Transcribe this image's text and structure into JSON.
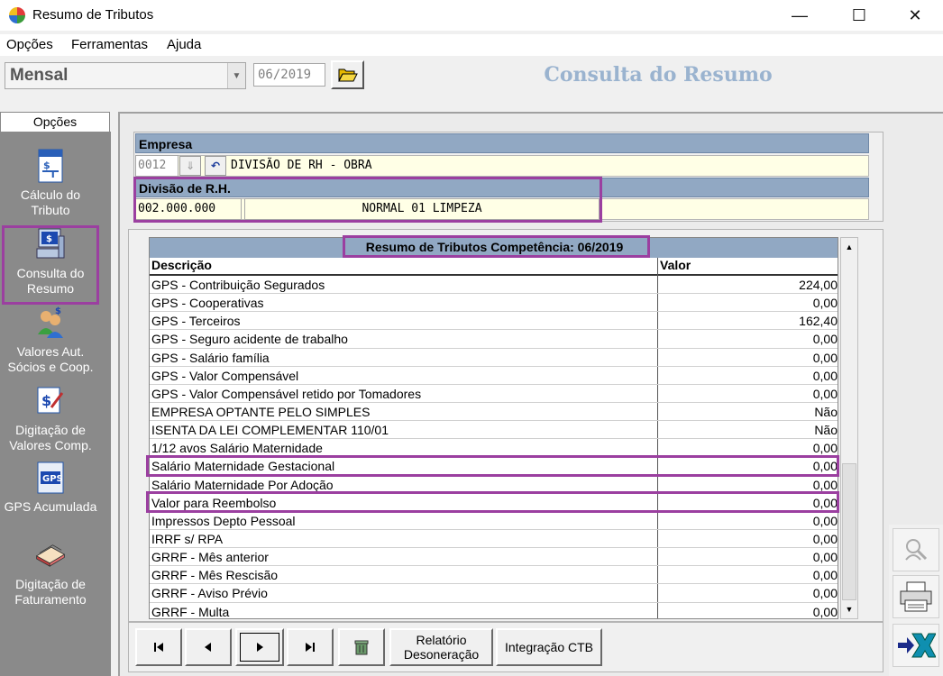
{
  "window": {
    "title": "Resumo de Tributos",
    "minimize": "—",
    "maximize": "☐",
    "close": "✕"
  },
  "menu": [
    "Opções",
    "Ferramentas",
    "Ajuda"
  ],
  "toolbar": {
    "period": "Mensal",
    "competencia": "06/2019",
    "header": "Consulta do Resumo"
  },
  "sidebar": {
    "tab": "Opções",
    "items": [
      {
        "label": "Cálculo do Tributo",
        "icon": "calc-document-icon"
      },
      {
        "label": "Consulta do Resumo",
        "icon": "computer-dollar-icon"
      },
      {
        "label": "Valores Aut. Sócios e Coop.",
        "icon": "users-dollar-icon"
      },
      {
        "label": "Digitação de Valores Comp.",
        "icon": "dollar-edit-icon"
      },
      {
        "label": "GPS Acumulada",
        "icon": "gps-document-icon"
      },
      {
        "label": "Digitação de Faturamento",
        "icon": "books-icon"
      }
    ]
  },
  "empresa": {
    "header": "Empresa",
    "code": "0012",
    "name": "DIVISÃO DE RH - OBRA"
  },
  "divisao": {
    "header": "Divisão de R.H.",
    "code": "002.000.000",
    "name": "NORMAL 01 LIMPEZA"
  },
  "table": {
    "title": "Resumo de Tributos Competência: 06/2019",
    "columns": [
      "Descrição",
      "Valor"
    ],
    "rows": [
      [
        "GPS - Contribuição Segurados",
        "224,00"
      ],
      [
        "GPS - Cooperativas",
        "0,00"
      ],
      [
        "GPS - Terceiros",
        "162,40"
      ],
      [
        "GPS - Seguro acidente de trabalho",
        "0,00"
      ],
      [
        "GPS - Salário família",
        "0,00"
      ],
      [
        "GPS - Valor Compensável",
        "0,00"
      ],
      [
        "GPS - Valor Compensável retido por Tomadores",
        "0,00"
      ],
      [
        "EMPRESA OPTANTE PELO SIMPLES",
        "Não"
      ],
      [
        "ISENTA DA LEI COMPLEMENTAR 110/01",
        "Não"
      ],
      [
        "1/12 avos Salário Maternidade",
        "0,00"
      ],
      [
        "Salário Maternidade Gestacional",
        "0,00"
      ],
      [
        "Salário Maternidade Por Adoção",
        "0,00"
      ],
      [
        "Valor para Reembolso",
        "0,00"
      ],
      [
        "Impressos Depto Pessoal",
        "0,00"
      ],
      [
        "IRRF s/ RPA",
        "0,00"
      ],
      [
        "GRRF - Mês anterior",
        "0,00"
      ],
      [
        "GRRF - Mês Rescisão",
        "0,00"
      ],
      [
        "GRRF - Aviso Prévio",
        "0,00"
      ],
      [
        "GRRF - Multa",
        "0,00"
      ]
    ]
  },
  "buttons": {
    "relatorio": "Relatório Desoneração",
    "integracao": "Integração CTB"
  },
  "colors": {
    "header_blue": "#91a8c3",
    "highlight_purple": "#9b3fa0",
    "sidebar_gray": "#8a8a8a",
    "field_yellow": "#ffffe6",
    "title_blue": "#9ab3cf"
  }
}
